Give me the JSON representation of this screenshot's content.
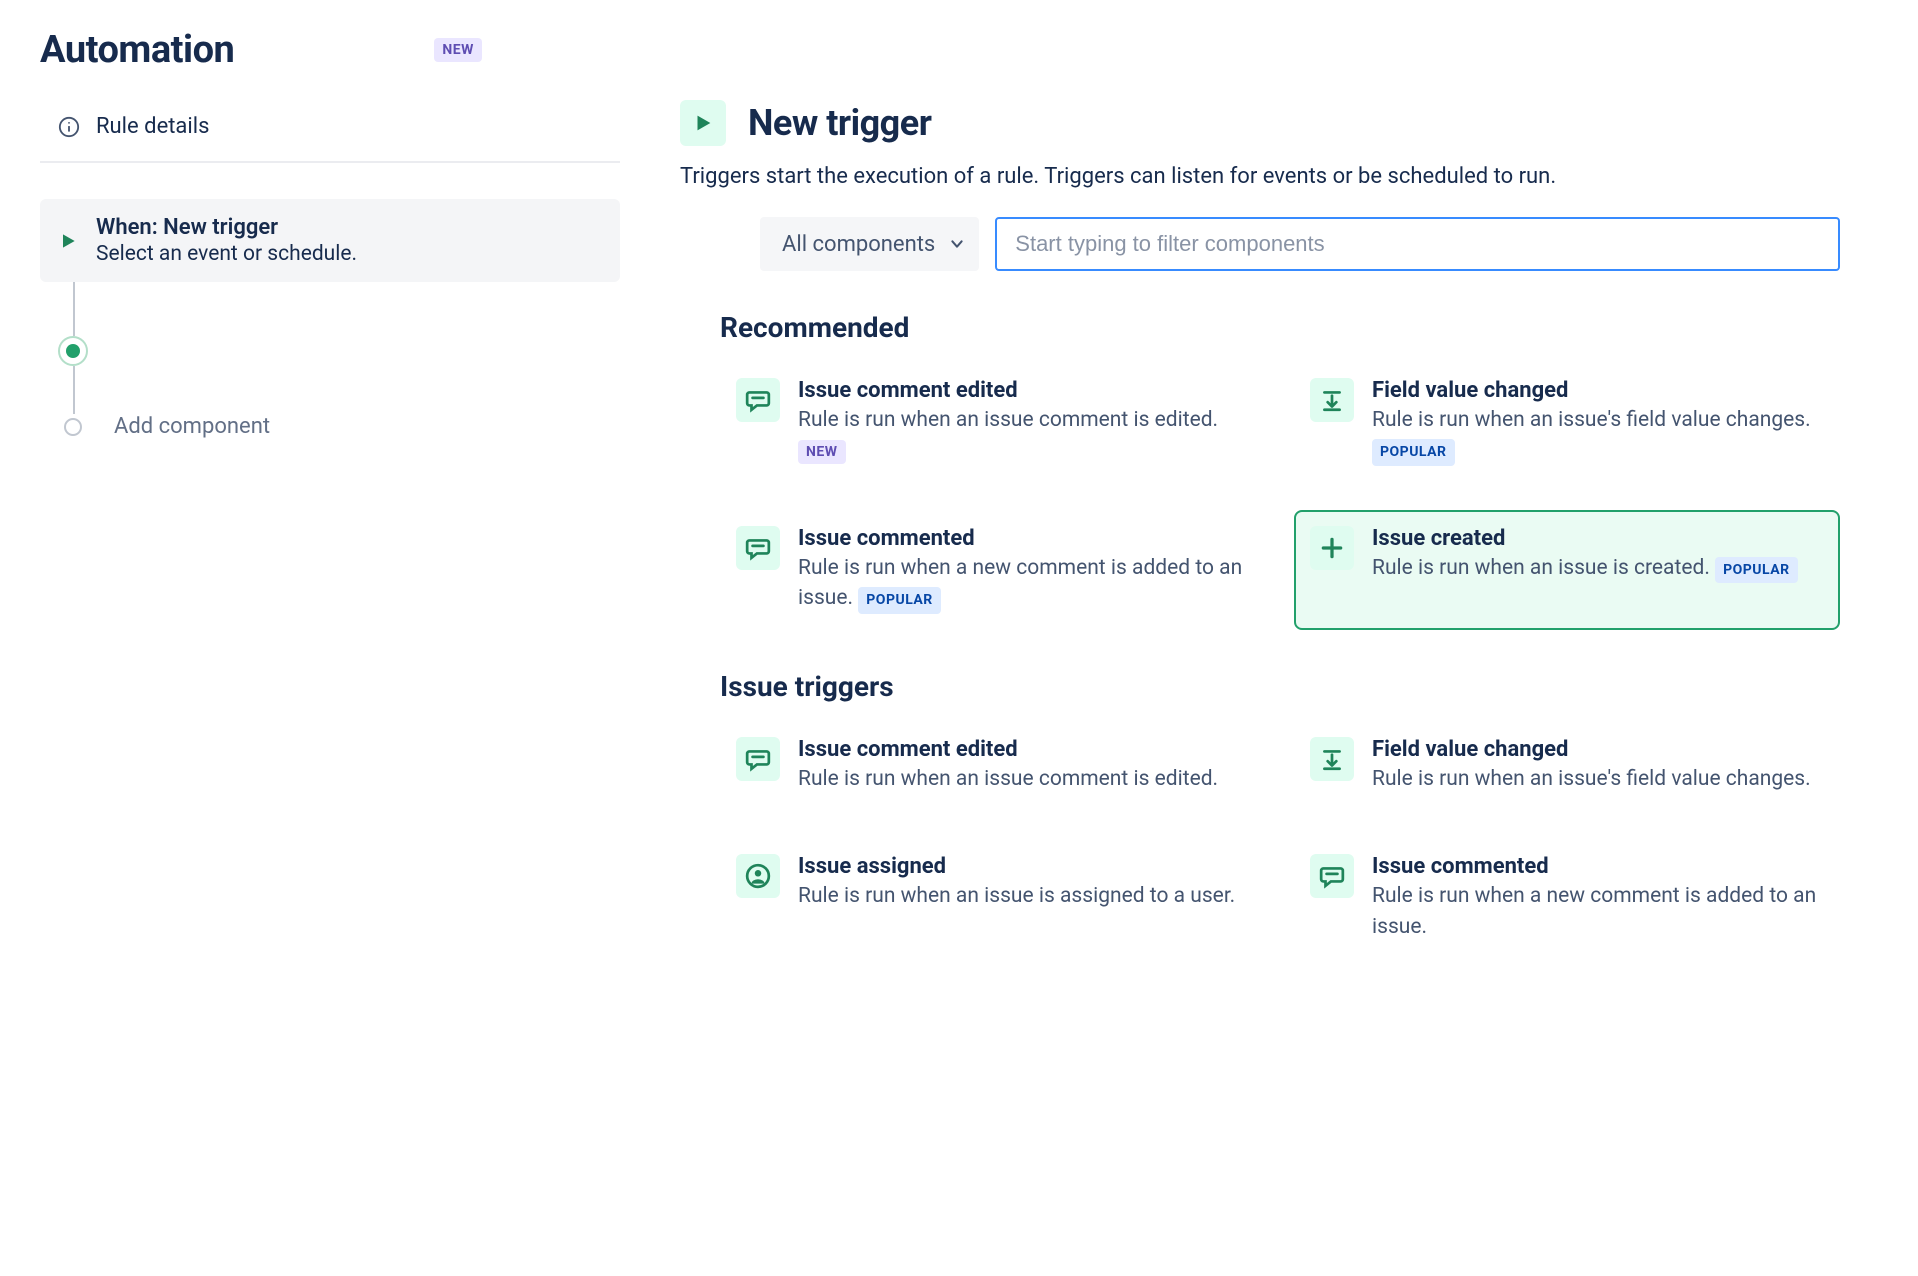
{
  "header": {
    "title": "Automation",
    "new_badge": "NEW"
  },
  "sidebar": {
    "rule_details_label": "Rule details",
    "step_title": "When: New trigger",
    "step_subtitle": "Select an event or schedule.",
    "add_component_label": "Add component"
  },
  "main": {
    "title": "New trigger",
    "description": "Triggers start the execution of a rule. Triggers can listen for events or be scheduled to run.",
    "dropdown_label": "All components",
    "filter_placeholder": "Start typing to filter components"
  },
  "sections": {
    "recommended_title": "Recommended",
    "issue_triggers_title": "Issue triggers"
  },
  "triggers": {
    "rec0": {
      "title": "Issue comment edited",
      "desc": "Rule is run when an issue comment is edited.",
      "badge": "NEW"
    },
    "rec1": {
      "title": "Field value changed",
      "desc": "Rule is run when an issue's field value changes.",
      "badge": "POPULAR"
    },
    "rec2": {
      "title": "Issue commented",
      "desc": "Rule is run when a new comment is added to an issue.",
      "badge": "POPULAR"
    },
    "rec3": {
      "title": "Issue created",
      "desc": "Rule is run when an issue is created.",
      "badge": "POPULAR"
    },
    "it0": {
      "title": "Issue comment edited",
      "desc": "Rule is run when an issue comment is edited."
    },
    "it1": {
      "title": "Field value changed",
      "desc": "Rule is run when an issue's field value changes."
    },
    "it2": {
      "title": "Issue assigned",
      "desc": "Rule is run when an issue is assigned to a user."
    },
    "it3": {
      "title": "Issue commented",
      "desc": "Rule is run when a new comment is added to an issue."
    }
  }
}
